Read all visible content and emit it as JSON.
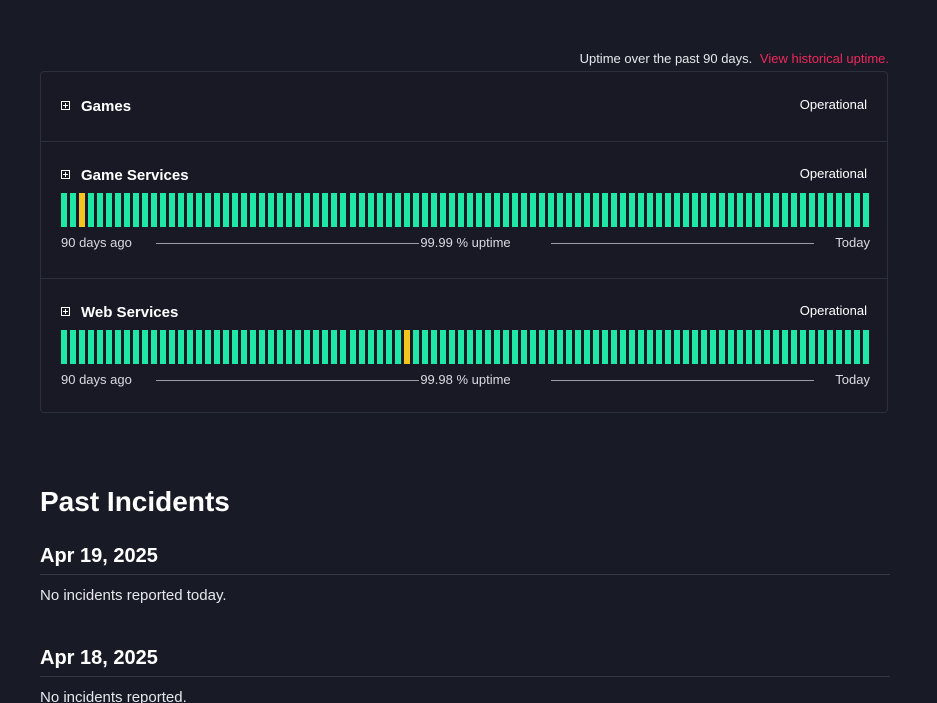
{
  "uptime_note": {
    "text": "Uptime over the past 90 days.",
    "link": "View historical uptime."
  },
  "components": [
    {
      "name": "Games",
      "status": "Operational",
      "expandable": true
    },
    {
      "name": "Game Services",
      "status": "Operational",
      "expandable": true,
      "bars_count": 90,
      "warning_days": [
        2
      ],
      "range_start": "90 days ago",
      "uptime": "99.99 % uptime",
      "range_end": "Today"
    },
    {
      "name": "Web Services",
      "status": "Operational",
      "expandable": true,
      "bars_count": 90,
      "warning_days": [
        38
      ],
      "range_start": "90 days ago",
      "uptime": "99.98 % uptime",
      "range_end": "Today"
    }
  ],
  "colors": {
    "operational": "#1fe7a5",
    "warning": "#f4c51e",
    "link": "#f0275d",
    "background": "#181a26"
  },
  "past_incidents": {
    "title": "Past Incidents",
    "days": [
      {
        "date": "Apr 19, 2025",
        "message": "No incidents reported today."
      },
      {
        "date": "Apr 18, 2025",
        "message": "No incidents reported."
      }
    ]
  }
}
